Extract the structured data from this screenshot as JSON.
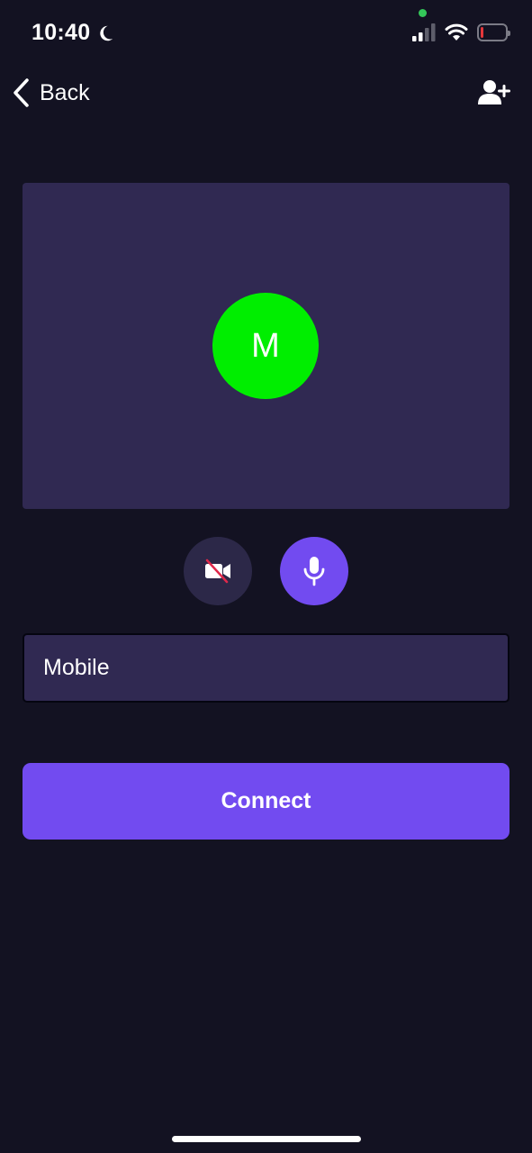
{
  "status_bar": {
    "time": "10:40",
    "privacy_dot_color": "#34c759",
    "battery_color": "#e5373a",
    "battery_level": 0.12
  },
  "nav": {
    "back_label": "Back",
    "back_icon": "chevron-left-icon",
    "add_user_icon": "user-plus-icon"
  },
  "preview": {
    "avatar_letter": "M",
    "avatar_color": "#00ee00"
  },
  "controls": {
    "video_icon": "video-off-icon",
    "mic_icon": "microphone-icon",
    "video_off_slash_color": "#e0284a"
  },
  "name_field": {
    "value": "Mobile"
  },
  "connect": {
    "label": "Connect"
  },
  "colors": {
    "background": "#131222",
    "panel": "#302952",
    "accent": "#724bf0"
  }
}
